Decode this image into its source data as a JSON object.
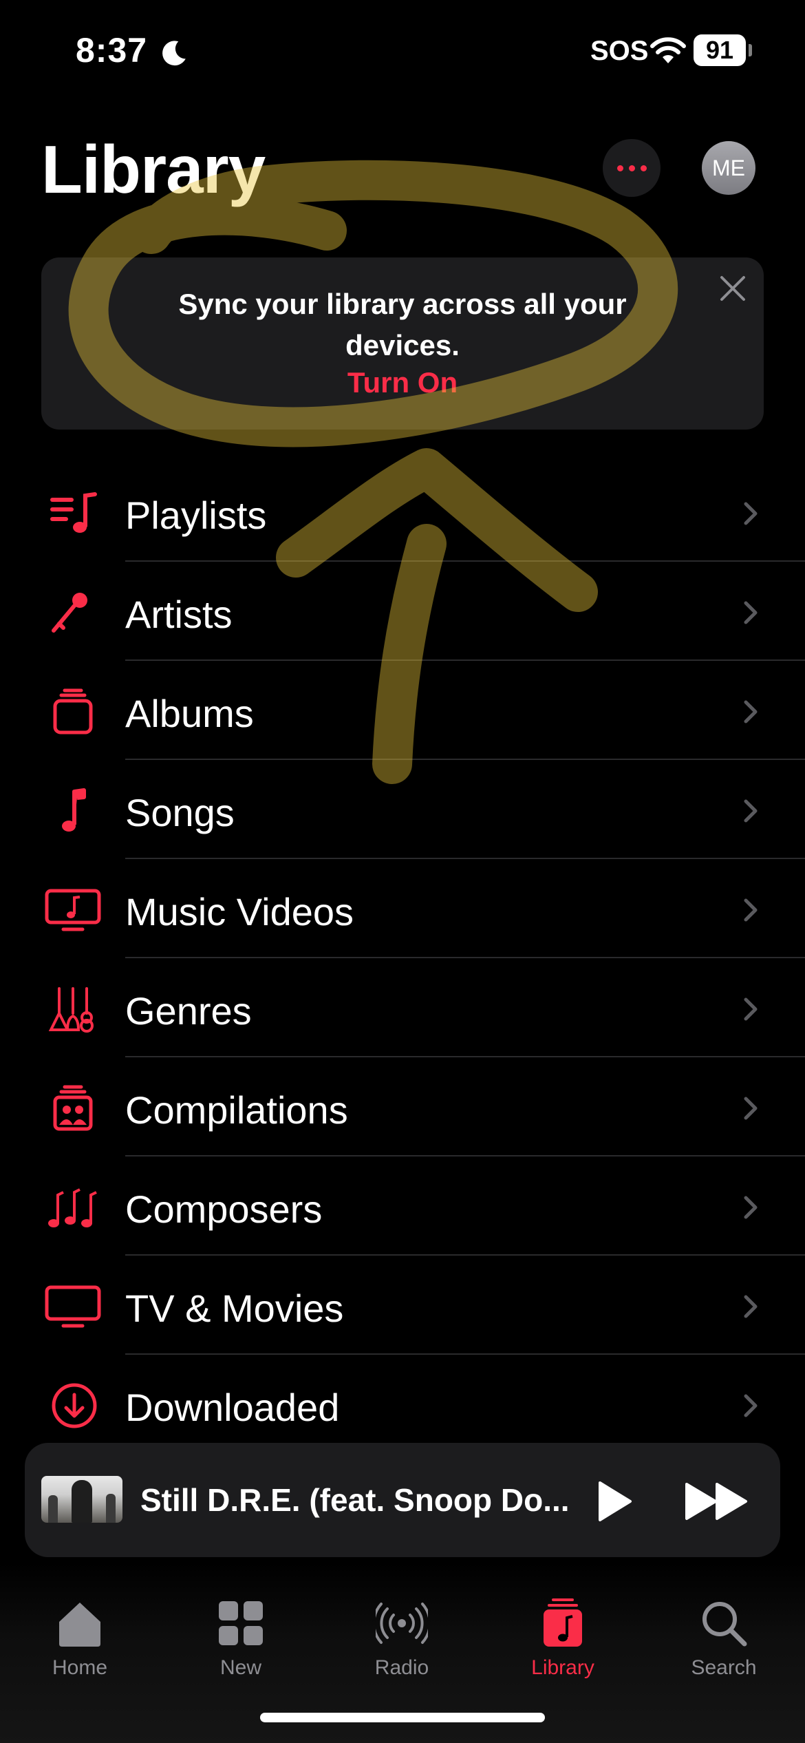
{
  "status_bar": {
    "time": "8:37",
    "carrier": "SOS",
    "battery": "91"
  },
  "header": {
    "title": "Library",
    "avatar_initials": "ME"
  },
  "sync_card": {
    "message": "Sync your library across all your devices.",
    "action": "Turn On"
  },
  "library_items": [
    {
      "label": "Playlists",
      "icon": "playlist-icon"
    },
    {
      "label": "Artists",
      "icon": "microphone-icon"
    },
    {
      "label": "Albums",
      "icon": "album-stack-icon"
    },
    {
      "label": "Songs",
      "icon": "music-note-icon"
    },
    {
      "label": "Music Videos",
      "icon": "music-video-icon"
    },
    {
      "label": "Genres",
      "icon": "guitars-icon"
    },
    {
      "label": "Compilations",
      "icon": "compilation-icon"
    },
    {
      "label": "Composers",
      "icon": "composers-notes-icon"
    },
    {
      "label": "TV & Movies",
      "icon": "tv-icon"
    },
    {
      "label": "Downloaded",
      "icon": "download-circle-icon"
    }
  ],
  "now_playing": {
    "title": "Still D.R.E. (feat. Snoop Do..."
  },
  "tabs": [
    {
      "label": "Home",
      "icon": "house-icon",
      "active": false
    },
    {
      "label": "New",
      "icon": "grid-icon",
      "active": false
    },
    {
      "label": "Radio",
      "icon": "radio-waves-icon",
      "active": false
    },
    {
      "label": "Library",
      "icon": "library-music-icon",
      "active": true
    },
    {
      "label": "Search",
      "icon": "magnifier-icon",
      "active": false
    }
  ],
  "colors": {
    "accent": "#fa2d48",
    "background": "#000000",
    "card": "#1c1c1e",
    "annotation": "#e8c33a"
  }
}
